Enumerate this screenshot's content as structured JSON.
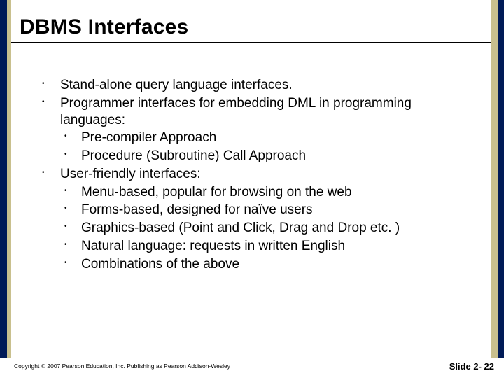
{
  "title": "DBMS Interfaces",
  "bullets": {
    "b1": "Stand-alone query language interfaces.",
    "b2": "Programmer interfaces for embedding DML in programming languages:",
    "b2a": "Pre-compiler Approach",
    "b2b": "Procedure (Subroutine) Call Approach",
    "b3": "User-friendly interfaces:",
    "b3a": "Menu-based, popular for browsing on the web",
    "b3b": "Forms-based, designed for naïve users",
    "b3c": "Graphics-based (Point and Click, Drag and Drop etc. )",
    "b3d": "Natural language: requests in written English",
    "b3e": "Combinations of the above"
  },
  "footer": {
    "copyright": "Copyright © 2007 Pearson Education, Inc. Publishing as Pearson Addison-Wesley",
    "slide_label": "Slide 2- 22"
  }
}
